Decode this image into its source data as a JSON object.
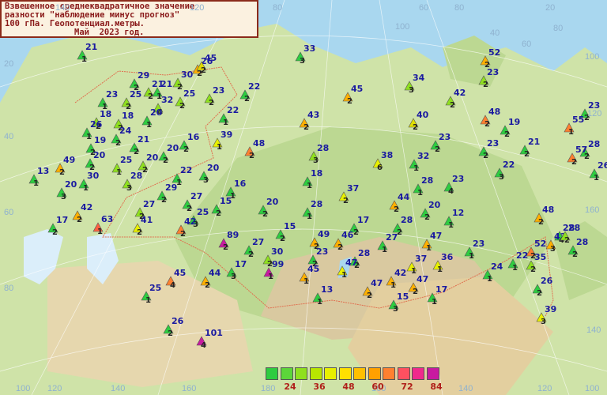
{
  "title": {
    "line1": "Взвешенное среднеквадратичное значение",
    "line2": "разности \"наблюдение минус прогноз\"",
    "line3": "100 гПа. Геопотенциал.метры.",
    "line4": "Май  2023 год."
  },
  "grid_labels": [
    "80",
    "60",
    "100",
    "120",
    "140",
    "20",
    "40",
    "60",
    "80",
    "100",
    "120",
    "140",
    "160",
    "180",
    "160",
    "140",
    "120",
    "100",
    "80",
    "20",
    "40",
    "60",
    "80",
    "100",
    "120",
    "140",
    "160"
  ],
  "legend": {
    "colors": [
      "#2ecc40",
      "#5cd63a",
      "#8fe01e",
      "#b8e600",
      "#e8f000",
      "#ffe000",
      "#ffc000",
      "#ffa000",
      "#ff8030",
      "#ff5060",
      "#f02a8c",
      "#c81aa0"
    ],
    "labels": [
      "24",
      "36",
      "48",
      "60",
      "72",
      "84"
    ]
  },
  "stations": [
    {
      "v": "21",
      "s": "1",
      "c": "#2ecc40"
    },
    {
      "v": "33",
      "s": "3",
      "c": "#2ecc40"
    },
    {
      "v": "52",
      "s": "2",
      "c": "#ffb000"
    },
    {
      "v": "29",
      "s": "2",
      "c": "#2ecc40"
    },
    {
      "v": "30",
      "s": "2",
      "c": "#8fe01e"
    },
    {
      "v": "26",
      "s": "2",
      "c": "#ffb000"
    },
    {
      "v": "45",
      "s": "2",
      "c": "#e0d800"
    },
    {
      "v": "23",
      "s": "2",
      "c": "#8fe01e"
    },
    {
      "v": "34",
      "s": "3",
      "c": "#8fe01e"
    },
    {
      "v": "23",
      "s": "2",
      "c": "#8fe01e"
    },
    {
      "v": "25",
      "s": "2",
      "c": "#8fe01e"
    },
    {
      "v": "21",
      "s": "2",
      "c": "#8fe01e"
    },
    {
      "v": "25",
      "s": "2",
      "c": "#8fe01e"
    },
    {
      "v": "23",
      "s": "1",
      "c": "#2ecc40"
    },
    {
      "v": "22",
      "s": "2",
      "c": "#2ecc40"
    },
    {
      "v": "45",
      "s": "2",
      "c": "#ffb000"
    },
    {
      "v": "42",
      "s": "2",
      "c": "#8fe01e"
    },
    {
      "v": "23",
      "s": "2",
      "c": "#2ecc40"
    },
    {
      "v": "21",
      "s": "1",
      "c": "#2ecc40"
    },
    {
      "v": "32",
      "s": "4",
      "c": "#8fe01e"
    },
    {
      "v": "22",
      "s": "1",
      "c": "#2ecc40"
    },
    {
      "v": "43",
      "s": "2",
      "c": "#ffb000"
    },
    {
      "v": "40",
      "s": "2",
      "c": "#e0e000"
    },
    {
      "v": "48",
      "s": "2",
      "c": "#ff8030"
    },
    {
      "v": "19",
      "s": "2",
      "c": "#2ecc40"
    },
    {
      "v": "55",
      "s": "1",
      "c": "#ff8030"
    },
    {
      "v": "18",
      "s": "2",
      "c": "#8fe01e"
    },
    {
      "v": "18",
      "s": "2",
      "c": "#8fe01e"
    },
    {
      "v": "20",
      "s": "1",
      "c": "#2ecc40"
    },
    {
      "v": "26",
      "s": "1",
      "c": "#2ecc40"
    },
    {
      "v": "24",
      "s": "2",
      "c": "#2ecc40"
    },
    {
      "v": "39",
      "s": "1",
      "c": "#e8f000"
    },
    {
      "v": "23",
      "s": "2",
      "c": "#2ecc40"
    },
    {
      "v": "19",
      "s": "2",
      "c": "#2ecc40"
    },
    {
      "v": "21",
      "s": "2",
      "c": "#2ecc40"
    },
    {
      "v": "28",
      "s": "2",
      "c": "#2ecc40"
    },
    {
      "v": "20",
      "s": "2",
      "c": "#2ecc40"
    },
    {
      "v": "16",
      "s": "2",
      "c": "#2ecc40"
    },
    {
      "v": "48",
      "s": "2",
      "c": "#ff8030"
    },
    {
      "v": "28",
      "s": "3",
      "c": "#8fe01e"
    },
    {
      "v": "23",
      "s": "2",
      "c": "#2ecc40"
    },
    {
      "v": "21",
      "s": "2",
      "c": "#2ecc40"
    },
    {
      "v": "57",
      "s": "2",
      "c": "#ff8030"
    },
    {
      "v": "20",
      "s": "2",
      "c": "#2ecc40"
    },
    {
      "v": "20",
      "s": "2",
      "c": "#8fe01e"
    },
    {
      "v": "38",
      "s": "6",
      "c": "#e8f000"
    },
    {
      "v": "32",
      "s": "1",
      "c": "#2ecc40"
    },
    {
      "v": "22",
      "s": "3",
      "c": "#2ecc40"
    },
    {
      "v": "26",
      "s": "1",
      "c": "#2ecc40"
    },
    {
      "v": "49",
      "s": "2",
      "c": "#ffb000"
    },
    {
      "v": "25",
      "s": "1",
      "c": "#8fe01e"
    },
    {
      "v": "30",
      "s": "1",
      "c": "#2ecc40"
    },
    {
      "v": "22",
      "s": "1",
      "c": "#2ecc40"
    },
    {
      "v": "20",
      "s": "3",
      "c": "#2ecc40"
    },
    {
      "v": "13",
      "s": "1",
      "c": "#2ecc40"
    },
    {
      "v": "18",
      "s": "1",
      "c": "#2ecc40"
    },
    {
      "v": "20",
      "s": "3",
      "c": "#2ecc40"
    },
    {
      "v": "28",
      "s": "3",
      "c": "#8fe01e"
    },
    {
      "v": "37",
      "s": "2",
      "c": "#e8f000"
    },
    {
      "v": "23",
      "s": "4",
      "c": "#2ecc40"
    },
    {
      "v": "29",
      "s": "2",
      "c": "#2ecc40"
    },
    {
      "v": "16",
      "s": "1",
      "c": "#2ecc40"
    },
    {
      "v": "28",
      "s": "1",
      "c": "#2ecc40"
    },
    {
      "v": "27",
      "s": "2",
      "c": "#2ecc40"
    },
    {
      "v": "15",
      "s": "2",
      "c": "#2ecc40"
    },
    {
      "v": "44",
      "s": "2",
      "c": "#ffb000"
    },
    {
      "v": "20",
      "s": "2",
      "c": "#2ecc40"
    },
    {
      "v": "28",
      "s": "1",
      "c": "#2ecc40"
    },
    {
      "v": "12",
      "s": "1",
      "c": "#2ecc40"
    },
    {
      "v": "25",
      "s": "3",
      "c": "#2ecc40"
    },
    {
      "v": "20",
      "s": "2",
      "c": "#2ecc40"
    },
    {
      "v": "42",
      "s": "2",
      "c": "#ffb000"
    },
    {
      "v": "27",
      "s": "2",
      "c": "#8fe01e"
    },
    {
      "v": "17",
      "s": "2",
      "c": "#2ecc40"
    },
    {
      "v": "48",
      "s": "2",
      "c": "#ffb000"
    },
    {
      "v": "28",
      "s": "2",
      "c": "#2ecc40"
    },
    {
      "v": "28",
      "s": "4",
      "c": "#2ecc40"
    },
    {
      "v": "17",
      "s": "2",
      "c": "#2ecc40"
    },
    {
      "v": "63",
      "s": "1",
      "c": "#ff6040"
    },
    {
      "v": "41",
      "s": "2",
      "c": "#e8f000"
    },
    {
      "v": "42",
      "s": "2",
      "c": "#ff8030"
    },
    {
      "v": "15",
      "s": "2",
      "c": "#2ecc40"
    },
    {
      "v": "49",
      "s": "2",
      "c": "#ffb000"
    },
    {
      "v": "46",
      "s": "2",
      "c": "#ffb000"
    },
    {
      "v": "27",
      "s": "1",
      "c": "#2ecc40"
    },
    {
      "v": "47",
      "s": "1",
      "c": "#ffb000"
    },
    {
      "v": "23",
      "s": "1",
      "c": "#2ecc40"
    },
    {
      "v": "43",
      "s": "3",
      "c": "#ffb000"
    },
    {
      "v": "52",
      "s": "2",
      "c": "#ff8030"
    },
    {
      "v": "28",
      "s": "2",
      "c": "#8fe01e"
    },
    {
      "v": "28",
      "s": "2",
      "c": "#2ecc40"
    },
    {
      "v": "89",
      "s": "2",
      "c": "#c81aa0"
    },
    {
      "v": "27",
      "s": "2",
      "c": "#2ecc40"
    },
    {
      "v": "30",
      "s": "2",
      "c": "#8fe01e"
    },
    {
      "v": "23",
      "s": "2",
      "c": "#2ecc40"
    },
    {
      "v": "28",
      "s": "2",
      "c": "#2ecc40"
    },
    {
      "v": "37",
      "s": "1",
      "c": "#e8f000"
    },
    {
      "v": "36",
      "s": "1",
      "c": "#e8f000"
    },
    {
      "v": "22",
      "s": "1",
      "c": "#2ecc40"
    },
    {
      "v": "35",
      "s": "2",
      "c": "#8fe01e"
    },
    {
      "v": "17",
      "s": "3",
      "c": "#2ecc40"
    },
    {
      "v": "99",
      "s": "1",
      "c": "#c81aa0"
    },
    {
      "v": "45",
      "s": "1",
      "c": "#ffb000"
    },
    {
      "v": "47",
      "s": "1",
      "c": "#e8f000"
    },
    {
      "v": "42",
      "s": "1",
      "c": "#ffb000"
    },
    {
      "v": "24",
      "s": "1",
      "c": "#2ecc40"
    },
    {
      "v": "45",
      "s": "4",
      "c": "#ff8030"
    },
    {
      "v": "44",
      "s": "2",
      "c": "#ffb000"
    },
    {
      "v": "47",
      "s": "2",
      "c": "#ffb000"
    },
    {
      "v": "47",
      "s": "2",
      "c": "#ffb000"
    },
    {
      "v": "17",
      "s": "1",
      "c": "#2ecc40"
    },
    {
      "v": "26",
      "s": "2",
      "c": "#2ecc40"
    },
    {
      "v": "25",
      "s": "1",
      "c": "#2ecc40"
    },
    {
      "v": "13",
      "s": "1",
      "c": "#2ecc40"
    },
    {
      "v": "15",
      "s": "3",
      "c": "#2ecc40"
    },
    {
      "v": "39",
      "s": "3",
      "c": "#e8f000"
    },
    {
      "v": "26",
      "s": "2",
      "c": "#2ecc40"
    },
    {
      "v": "101",
      "s": "4",
      "c": "#c81aa0"
    },
    {
      "v": "47",
      "s": "1",
      "c": "#ffb000"
    }
  ]
}
